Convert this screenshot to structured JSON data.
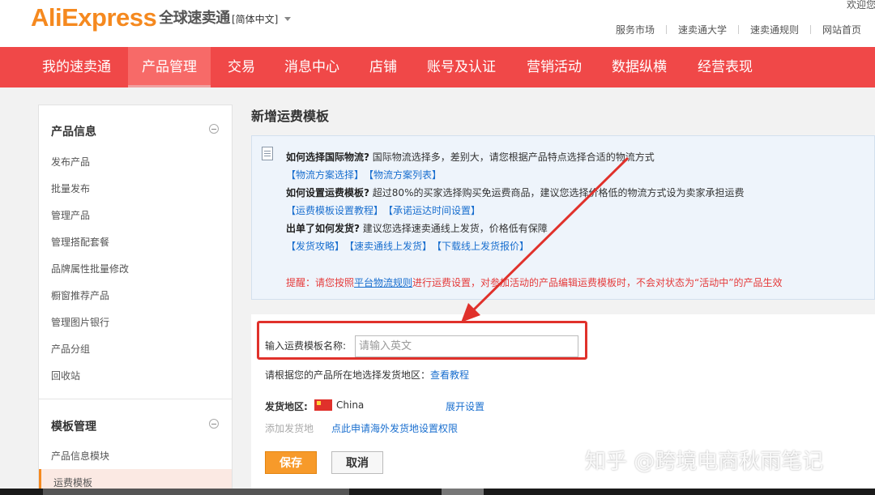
{
  "header": {
    "logo_ali": "AliExpress",
    "logo_cn": "全球速卖通",
    "language": "[简体中文]",
    "welcome": "欢迎您",
    "links": [
      "服务市场",
      "速卖通大学",
      "速卖通规则",
      "网站首页"
    ]
  },
  "nav": {
    "items": [
      "我的速卖通",
      "产品管理",
      "交易",
      "消息中心",
      "店铺",
      "账号及认证",
      "营销活动",
      "数据纵横",
      "经营表现"
    ],
    "active": "产品管理"
  },
  "sidebar": {
    "section1": {
      "title": "产品信息",
      "items": [
        "发布产品",
        "批量发布",
        "管理产品",
        "管理搭配套餐",
        "品牌属性批量修改",
        "橱窗推荐产品",
        "管理图片银行",
        "产品分组",
        "回收站"
      ]
    },
    "section2": {
      "title": "模板管理",
      "items": [
        "产品信息模块",
        "运费模板"
      ],
      "active": "运费模板"
    }
  },
  "main": {
    "title": "新增运费模板",
    "info": {
      "q1": "如何选择国际物流?",
      "a1": "国际物流选择多，差别大，请您根据产品特点选择合适的物流方式",
      "links1": [
        "【物流方案选择】",
        "【物流方案列表】"
      ],
      "q2": "如何设置运费模板?",
      "a2": "超过80%的买家选择购买免运费商品，建议您选择价格低的物流方式设为卖家承担运费",
      "links2": [
        "【运费模板设置教程】",
        "【承诺运达时间设置】"
      ],
      "q3": "出单了如何发货?",
      "a3": "建议您选择速卖通线上发货，价格低有保障",
      "links3": [
        "【发货攻略】",
        "【速卖通线上发货】",
        "【下载线上发货报价】"
      ],
      "notice_pre": "提醒：请您按照",
      "notice_link": "平台物流规则",
      "notice_post": "进行运费设置，对参加活动的产品编辑运费模板时，不会对状态为“活动中”的产品生效"
    },
    "form": {
      "name_label": "输入运费模板名称:",
      "name_placeholder": "请输入英文",
      "region_hint": "请根据您的产品所在地选择发货地区：",
      "tutorial_link": "查看教程",
      "ship_label": "发货地区:",
      "ship_value": "China",
      "expand_link": "展开设置",
      "add_region": "添加发货地",
      "apply_link": "点此申请海外发货地设置权限",
      "save": "保存",
      "cancel": "取消"
    }
  },
  "watermark": "知乎 @跨境电商秋雨笔记",
  "colors": {
    "nav_red": "#f04848",
    "brand_orange": "#f5891f",
    "link_blue": "#1a6fcf",
    "highlight_red": "#e0312b"
  }
}
